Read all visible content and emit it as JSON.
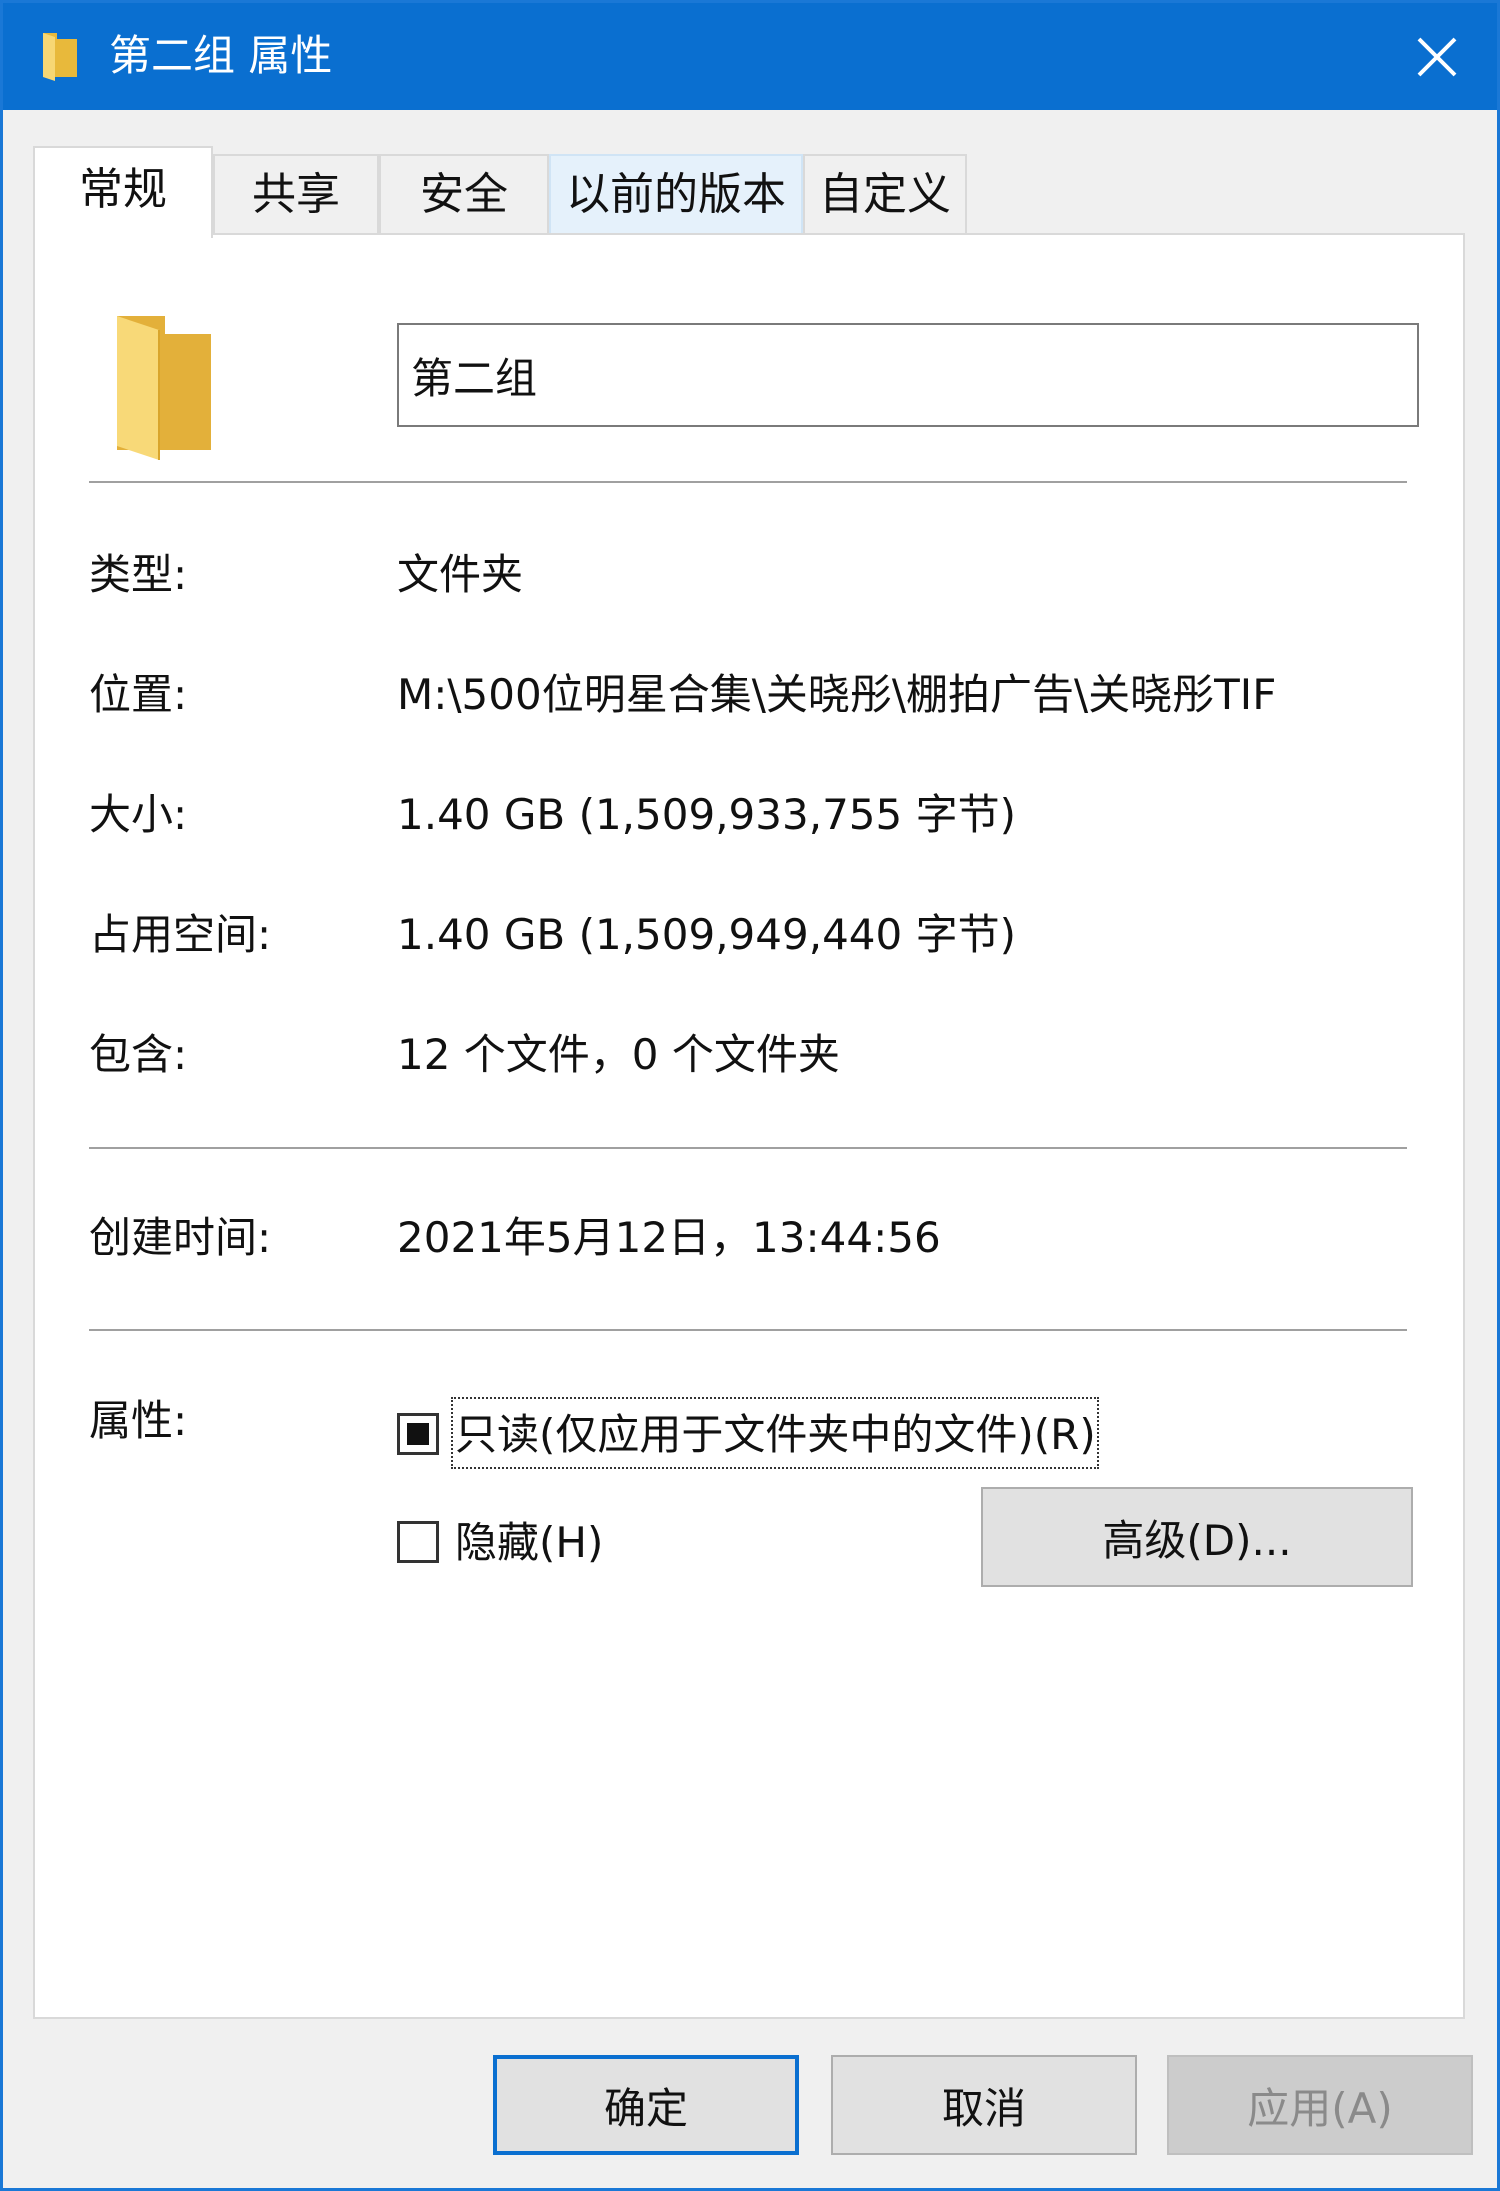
{
  "window": {
    "title": "第二组 属性",
    "close_icon": "close-icon",
    "accent_color": "#0a6fd0"
  },
  "tabs": [
    {
      "label": "常规",
      "active": true
    },
    {
      "label": "共享",
      "active": false
    },
    {
      "label": "安全",
      "active": false
    },
    {
      "label": "以前的版本",
      "active": false
    },
    {
      "label": "自定义",
      "active": false
    }
  ],
  "general": {
    "name_value": "第二组",
    "type_label": "类型:",
    "type_value": "文件夹",
    "location_label": "位置:",
    "location_value": "M:\\500位明星合集\\关晓彤\\棚拍广告\\关晓彤TIF",
    "size_label": "大小:",
    "size_value": "1.40 GB (1,509,933,755 字节)",
    "size_on_disk_label": "占用空间:",
    "size_on_disk_value": "1.40 GB (1,509,949,440 字节)",
    "contains_label": "包含:",
    "contains_value": "12 个文件，0 个文件夹",
    "created_label": "创建时间:",
    "created_value": "2021年5月12日，13:44:56",
    "attributes_label": "属性:",
    "readonly_label": "只读(仅应用于文件夹中的文件)(R)",
    "readonly_state": "indeterminate",
    "hidden_label": "隐藏(H)",
    "hidden_checked": false,
    "advanced_label": "高级(D)..."
  },
  "footer": {
    "ok_label": "确定",
    "cancel_label": "取消",
    "apply_label": "应用(A)",
    "apply_enabled": false
  }
}
